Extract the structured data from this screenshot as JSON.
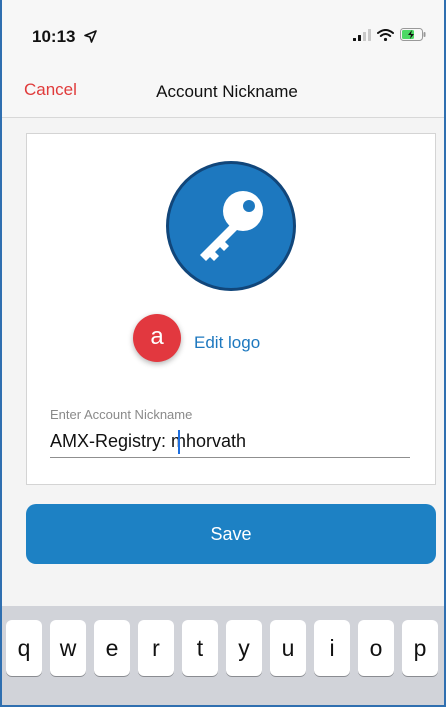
{
  "status_bar": {
    "time": "10:13",
    "icons": [
      "location-arrow-icon",
      "signal-icon",
      "wifi-icon",
      "battery-charging-icon"
    ]
  },
  "nav": {
    "cancel_label": "Cancel",
    "title": "Account Nickname"
  },
  "logo": {
    "icon": "key-icon",
    "badge_label": "a",
    "edit_label": "Edit logo"
  },
  "nickname_field": {
    "label": "Enter Account Nickname",
    "value": "AMX-Registry: mhorvath"
  },
  "save_label": "Save",
  "keyboard": {
    "row1": [
      "q",
      "w",
      "e",
      "r",
      "t",
      "y",
      "u",
      "i",
      "o",
      "p"
    ]
  },
  "colors": {
    "accent_blue": "#1d81c4",
    "cancel_red": "#e03b3b",
    "badge_red": "#e2383f"
  }
}
